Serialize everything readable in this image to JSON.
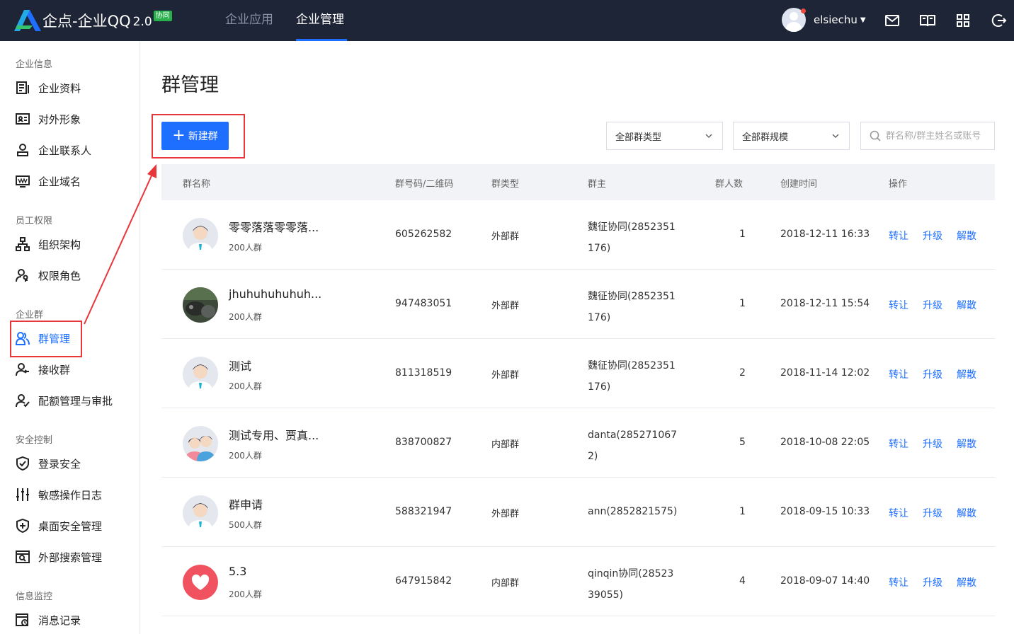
{
  "header": {
    "logo_text": "企点-企业QQ",
    "logo_version": "2.0",
    "logo_badge": "协同",
    "nav_tabs": [
      {
        "label": "企业应用",
        "active": false
      },
      {
        "label": "企业管理",
        "active": true
      }
    ],
    "username": "elsiechu",
    "icons": [
      "mail-icon",
      "book-icon",
      "apps-grid-icon",
      "logout-icon"
    ],
    "accent_color": "#1e6fff",
    "bar_color": "#1e2537"
  },
  "sidebar": {
    "sections": [
      {
        "title": "企业信息",
        "items": [
          {
            "label": "企业资料",
            "icon": "document-icon"
          },
          {
            "label": "对外形象",
            "icon": "id-card-icon"
          },
          {
            "label": "企业联系人",
            "icon": "contact-person-icon"
          },
          {
            "label": "企业域名",
            "icon": "domain-www-icon"
          }
        ]
      },
      {
        "title": "员工权限",
        "items": [
          {
            "label": "组织架构",
            "icon": "org-chart-icon"
          },
          {
            "label": "权限角色",
            "icon": "role-key-icon"
          }
        ]
      },
      {
        "title": "企业群",
        "items": [
          {
            "label": "群管理",
            "icon": "group-users-icon",
            "active": true
          },
          {
            "label": "接收群",
            "icon": "receive-group-icon"
          },
          {
            "label": "配额管理与审批",
            "icon": "quota-approve-icon"
          }
        ]
      },
      {
        "title": "安全控制",
        "items": [
          {
            "label": "登录安全",
            "icon": "shield-check-icon"
          },
          {
            "label": "敏感操作日志",
            "icon": "sliders-icon"
          },
          {
            "label": "桌面安全管理",
            "icon": "shield-plus-icon"
          },
          {
            "label": "外部搜索管理",
            "icon": "search-window-icon"
          }
        ]
      },
      {
        "title": "信息监控",
        "items": [
          {
            "label": "消息记录",
            "icon": "message-clock-icon"
          }
        ]
      }
    ]
  },
  "main": {
    "title": "群管理",
    "new_button": "新建群",
    "filter_type": "全部群类型",
    "filter_size": "全部群规模",
    "search_placeholder": "群名称/群主姓名或账号",
    "columns": [
      "群名称",
      "群号码/二维码",
      "群类型",
      "群主",
      "群人数",
      "创建时间",
      "操作"
    ],
    "actions": [
      "转让",
      "升级",
      "解散"
    ],
    "rows": [
      {
        "name": "零零落落零零落...",
        "size": "200人群",
        "number": "605262582",
        "type": "外部群",
        "owner": "魏征协同(2852351176)",
        "members": "1",
        "created": "2018-12-11 16:33",
        "avatar": "default-person"
      },
      {
        "name": "jhuhuhuhuhuh...",
        "size": "200人群",
        "number": "947483051",
        "type": "外部群",
        "owner": "魏征协同(2852351176)",
        "members": "1",
        "created": "2018-12-11 15:54",
        "avatar": "photo"
      },
      {
        "name": "测试",
        "size": "200人群",
        "number": "811318519",
        "type": "外部群",
        "owner": "魏征协同(2852351176)",
        "members": "2",
        "created": "2018-11-14 12:02",
        "avatar": "default-person"
      },
      {
        "name": "测试专用、贾真...",
        "size": "200人群",
        "number": "838700827",
        "type": "内部群",
        "owner": "danta(2852710672)",
        "members": "5",
        "created": "2018-10-08 22:05",
        "avatar": "couple"
      },
      {
        "name": "群申请",
        "size": "500人群",
        "number": "588321947",
        "type": "外部群",
        "owner": "ann(2852821575)",
        "members": "1",
        "created": "2018-09-15 10:33",
        "avatar": "default-person"
      },
      {
        "name": "5.3",
        "size": "200人群",
        "number": "647915842",
        "type": "内部群",
        "owner": "qinqin协同(2852339055)",
        "members": "4",
        "created": "2018-09-07 14:40",
        "avatar": "heart"
      }
    ]
  }
}
